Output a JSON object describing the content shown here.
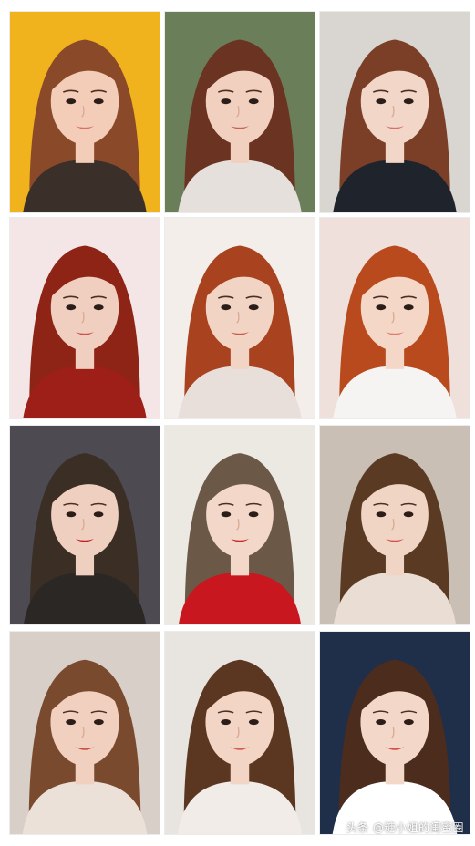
{
  "watermark": "头条 @糖小姐的闺蜜圈",
  "rows": [
    {
      "tiles": [
        {
          "bg": "#f0b21d",
          "hair": "#8a4a2a",
          "skin": "#f3cdb8",
          "top": "#3b2f2a",
          "lip": "#d9706e"
        },
        {
          "bg": "#6b7e5a",
          "hair": "#6a3322",
          "skin": "#f1d0c0",
          "top": "#e6e0dc",
          "lip": "#c4615a"
        },
        {
          "bg": "#d9d5d1",
          "hair": "#7b3f27",
          "skin": "#f2d6c7",
          "top": "#1f232b",
          "lip": "#d5726d"
        }
      ]
    },
    {
      "tiles": [
        {
          "bg": "#f4e6e6",
          "hair": "#8e2416",
          "skin": "#f0cfc0",
          "top": "#9e1e18",
          "lip": "#c85449"
        },
        {
          "bg": "#f3eeea",
          "hair": "#a8421f",
          "skin": "#f2d4c4",
          "top": "#e8dfdb",
          "lip": "#c85a4f"
        },
        {
          "bg": "#f0e0dc",
          "hair": "#b84a1d",
          "skin": "#f5d7c7",
          "top": "#f6f4f2",
          "lip": "#e07c6b"
        }
      ]
    },
    {
      "tiles": [
        {
          "bg": "#4d4a52",
          "hair": "#3a2e25",
          "skin": "#efcfbf",
          "top": "#2a2725",
          "lip": "#c21e23"
        },
        {
          "bg": "#ece8e2",
          "hair": "#6b5846",
          "skin": "#f3d7c8",
          "top": "#c8171e",
          "lip": "#c5272a"
        },
        {
          "bg": "#c9bfb4",
          "hair": "#5a3a22",
          "skin": "#f0d4c4",
          "top": "#e9ddd4",
          "lip": "#d3504c"
        }
      ]
    },
    {
      "tiles": [
        {
          "bg": "#d8cfc8",
          "hair": "#7a4a2e",
          "skin": "#f1d0bf",
          "top": "#ece1d8",
          "lip": "#c6534a"
        },
        {
          "bg": "#e8e4e0",
          "hair": "#5b3721",
          "skin": "#f3d5c6",
          "top": "#f1ece8",
          "lip": "#d55a58"
        },
        {
          "bg": "#1f2f4a",
          "hair": "#4c2c1d",
          "skin": "#f3d8c9",
          "top": "#ffffff",
          "lip": "#d74a4a"
        }
      ]
    }
  ]
}
